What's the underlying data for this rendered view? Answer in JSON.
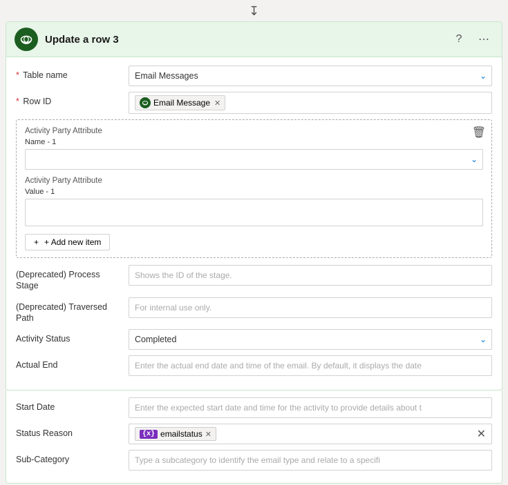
{
  "arrow": "⤓",
  "header": {
    "title": "Update a row 3",
    "icon_alt": "dataverse-icon",
    "help_label": "?",
    "more_label": "..."
  },
  "form": {
    "table_name_label": "Table name",
    "table_name_value": "Email Messages",
    "row_id_label": "Row ID",
    "row_id_chip_label": "Email Message",
    "dashed_section": {
      "attr_name_label": "Activity Party Attribute",
      "attr_name_sub": "Name - 1",
      "attr_value_label": "Activity Party Attribute",
      "attr_value_sub": "Value - 1",
      "add_btn_label": "+ Add new item"
    },
    "process_stage_label": "(Deprecated) Process Stage",
    "process_stage_placeholder": "Shows the ID of the stage.",
    "traversed_path_label": "(Deprecated) Traversed Path",
    "traversed_path_placeholder": "For internal use only.",
    "activity_status_label": "Activity Status",
    "activity_status_value": "Completed",
    "actual_end_label": "Actual End",
    "actual_end_placeholder": "Enter the actual end date and time of the email. By default, it displays the date"
  },
  "below": {
    "start_date_label": "Start Date",
    "start_date_placeholder": "Enter the expected start date and time for the activity to provide details about t",
    "status_reason_label": "Status Reason",
    "status_reason_chip_label": "emailstatus",
    "sub_category_label": "Sub-Category",
    "sub_category_placeholder": "Type a subcategory to identify the email type and relate to a specifi"
  }
}
